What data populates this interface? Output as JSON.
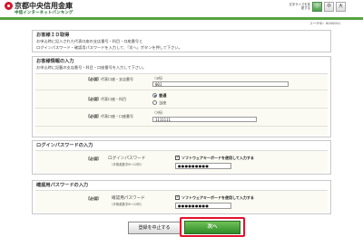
{
  "header": {
    "bank_name": "京都中央信用金庫",
    "service_name": "中信インターネットバンキング",
    "fontsize_label": "文字サイズを変更する",
    "fontsize_buttons": [
      "小",
      "中",
      "大"
    ],
    "fontsize_selected": 0
  },
  "user_id_label": "ユーザID：6000001",
  "section1": {
    "title": "お客様ＩＤ取得",
    "text1": "お申込時に記入された代表口座の支店番号・科目・口座番号と",
    "text2": "ログインパスワード・確認用パスワードを入力して、「次へ」ボタンを押して下さい。"
  },
  "section2": {
    "title": "お客様情報の入力",
    "text": "お申込時に記載の支店番号・科目・口座番号を入力して下さい。",
    "required": "【必須】",
    "branch_label": "代表口座・支店番号",
    "branch_hint": "（3桁）",
    "branch_value": "001",
    "subject_label": "代表口座・科目",
    "subject_options": [
      "普通",
      "当座"
    ],
    "subject_selected": "普通",
    "account_label": "代表口座・口座番号",
    "account_hint": "（7桁）",
    "account_value": "1111111"
  },
  "section3": {
    "title": "ログインパスワードの入力",
    "required": "【必須】",
    "label": "ログインパスワード",
    "note": "（半角英数字6〜12桁）",
    "checkbox_label": "ソフトウェアキーボードを使用して入力する",
    "value": "●●●●●●●●●"
  },
  "section4": {
    "title": "確認用パスワードの入力",
    "required": "【必須】",
    "label": "確認用パスワード",
    "note": "（半角英数字6〜12桁）",
    "checkbox_label": "ソフトウェアキーボードを使用して入力する",
    "value": "●●●●●●●●●"
  },
  "buttons": {
    "cancel": "登録を中止する",
    "next": "次へ"
  }
}
